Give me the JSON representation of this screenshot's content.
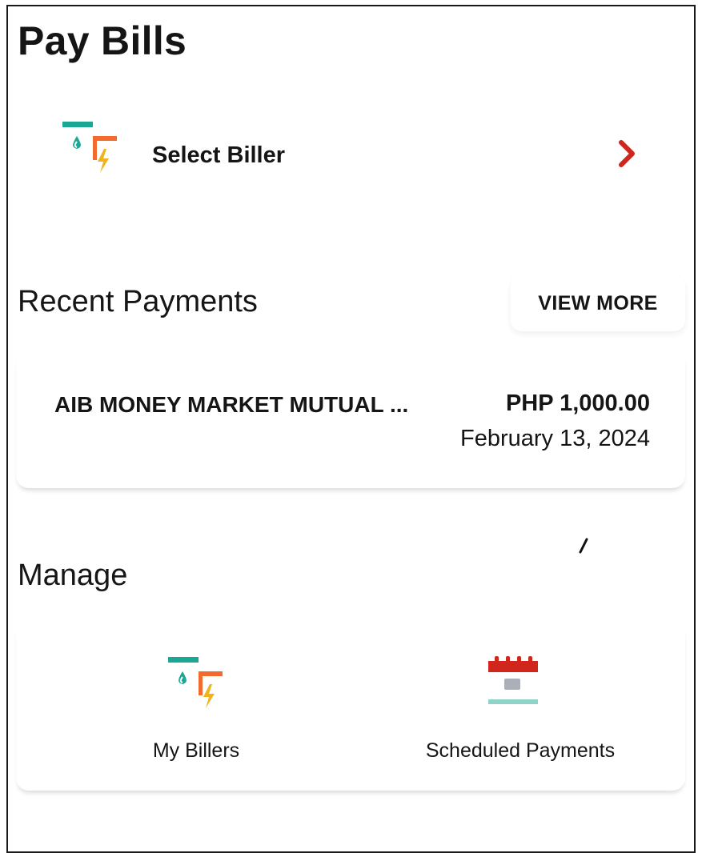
{
  "header": {
    "title": "Pay Bills"
  },
  "select_biller": {
    "label": "Select Biller",
    "icon": "bill-utilities-icon",
    "chevron": "chevron-right-icon"
  },
  "recent_payments": {
    "title": "Recent Payments",
    "view_more_label": "VIEW MORE",
    "items": [
      {
        "name": "AIB MONEY MARKET MUTUAL ...",
        "amount": "PHP 1,000.00",
        "date": "February 13, 2024"
      }
    ]
  },
  "manage": {
    "title": "Manage",
    "items": [
      {
        "label": "My Billers",
        "icon": "bill-utilities-icon"
      },
      {
        "label": "Scheduled Payments",
        "icon": "calendar-icon"
      }
    ]
  },
  "colors": {
    "accent_red": "#d0261c",
    "teal": "#1aa894",
    "orange": "#f26a2c",
    "bolt": "#f2b21c"
  }
}
